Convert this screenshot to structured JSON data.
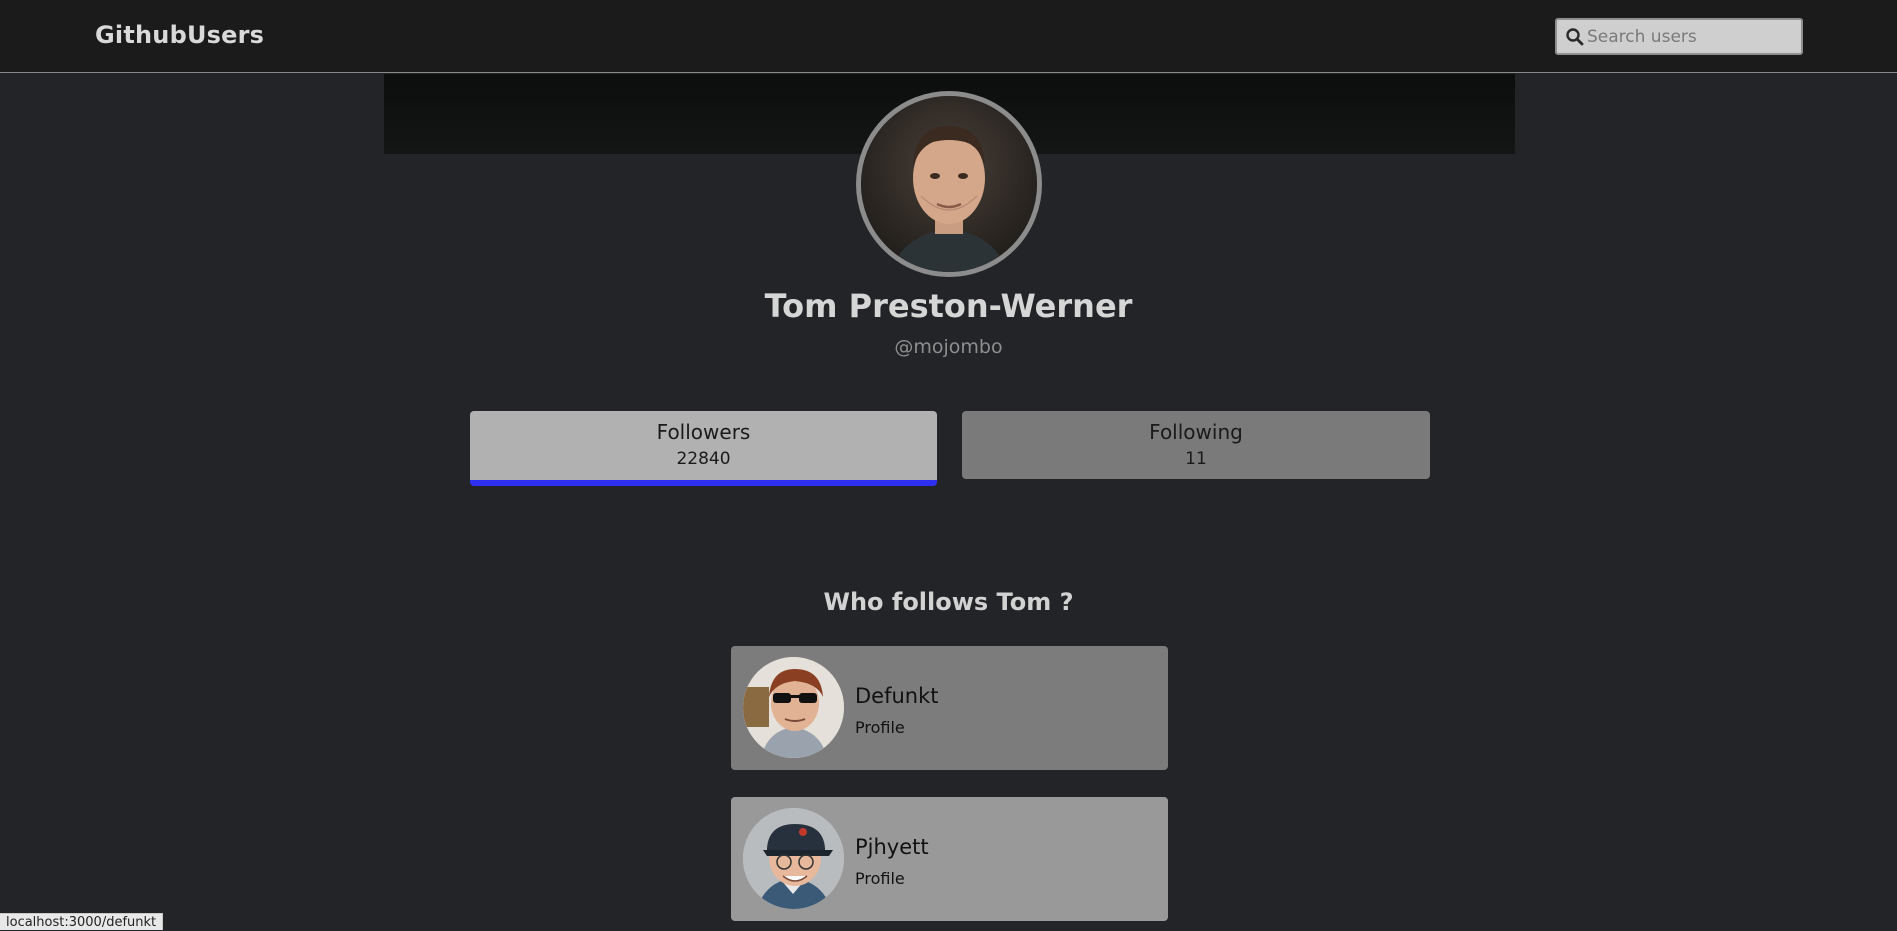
{
  "navbar": {
    "brand": "GithubUsers",
    "search_placeholder": "Search users",
    "search_value": ""
  },
  "profile": {
    "name": "Tom Preston-Werner",
    "handle": "@mojombo"
  },
  "stats": {
    "followers": {
      "label": "Followers",
      "value": "22840",
      "active": true
    },
    "following": {
      "label": "Following",
      "value": "11",
      "active": false
    }
  },
  "followers_section": {
    "title": "Who follows Tom ?",
    "users": [
      {
        "name": "Defunkt",
        "link_label": "Profile"
      },
      {
        "name": "Pjhyett",
        "link_label": "Profile"
      }
    ]
  },
  "status_bar": {
    "url": "localhost:3000/defunkt"
  },
  "colors": {
    "accent": "#2f2ff2",
    "topbar": "#1b1b1b",
    "page_bg": "#232427"
  }
}
